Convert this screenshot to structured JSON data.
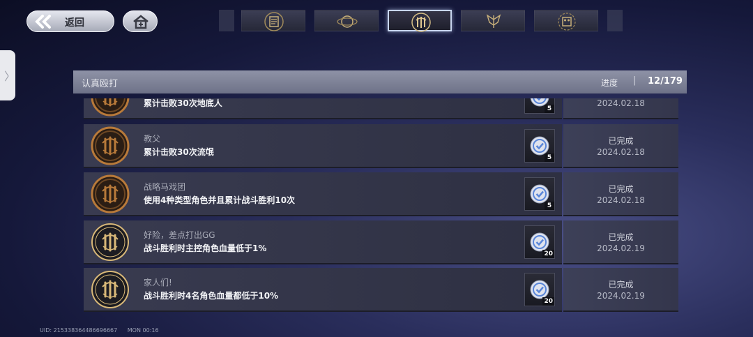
{
  "topbar": {
    "back_label": "返回"
  },
  "tabs": [
    {
      "icon": "document-emblem-icon",
      "active": false
    },
    {
      "icon": "planet-emblem-icon",
      "active": false
    },
    {
      "icon": "fist-emblem-icon",
      "active": true
    },
    {
      "icon": "wing-emblem-icon",
      "active": false
    },
    {
      "icon": "machine-emblem-icon",
      "active": false
    }
  ],
  "header": {
    "title": "认真殴打",
    "progress_label": "进度",
    "separator": "|",
    "progress_value": "12/179"
  },
  "achievements": [
    {
      "name": "",
      "desc": "累计击败30次地底人",
      "count": "5",
      "status": "",
      "date": "2024.02.18",
      "medal": "bronze"
    },
    {
      "name": "教父",
      "desc": "累计击败30次流氓",
      "count": "5",
      "status": "已完成",
      "date": "2024.02.18",
      "medal": "bronze"
    },
    {
      "name": "战略马戏团",
      "desc": "使用4种类型角色并且累计战斗胜利10次",
      "count": "5",
      "status": "已完成",
      "date": "2024.02.18",
      "medal": "bronze"
    },
    {
      "name": "好险，差点打出GG",
      "desc": "战斗胜利时主控角色血量低于1%",
      "count": "20",
      "status": "已完成",
      "date": "2024.02.19",
      "medal": "gold"
    },
    {
      "name": "家人们!",
      "desc": "战斗胜利时4名角色血量都低于10%",
      "count": "20",
      "status": "已完成",
      "date": "2024.02.19",
      "medal": "gold"
    }
  ],
  "footer": {
    "uid": "UID: 215338364486696667",
    "mon": "MON 00:16"
  },
  "colors": {
    "bronze": "#b87a3a",
    "gold": "#d8b878",
    "reward_check": "#5a86d8"
  }
}
